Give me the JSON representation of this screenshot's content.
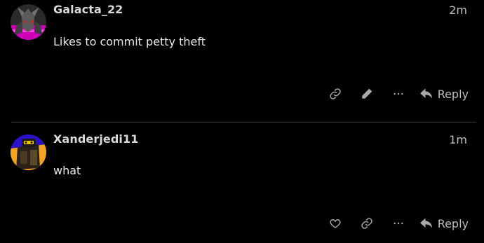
{
  "posts": [
    {
      "username": "Galacta_22",
      "time": "2m",
      "body": "Likes to commit petty theft",
      "actions": [
        "link-icon",
        "edit-icon",
        "more-icon"
      ],
      "reply_label": "Reply"
    },
    {
      "username": "Xanderjedi11",
      "time": "1m",
      "body": "what",
      "actions": [
        "heart-icon",
        "link-icon",
        "more-icon"
      ],
      "reply_label": "Reply"
    }
  ],
  "colors": {
    "background": "#000000",
    "text": "#e8e8e8",
    "muted": "#a8a8a8",
    "divider": "#3a3a3a"
  }
}
